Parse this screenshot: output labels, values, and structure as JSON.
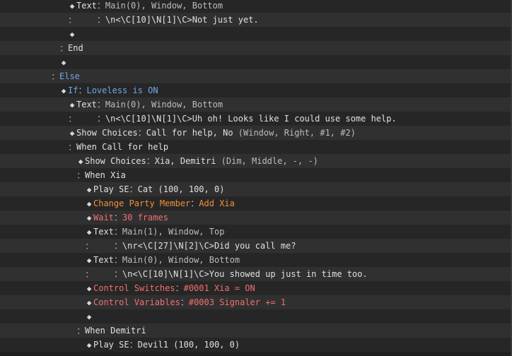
{
  "colors": {
    "default": "#e0e0e0",
    "params": "#bdbdbd",
    "flow": "#6fa8e8",
    "party": "#f0923a",
    "control": "#f07070"
  },
  "rows": [
    {
      "indent": 96,
      "marker": "diamond",
      "segs": [
        [
          "default",
          "Text"
        ],
        [
          "params",
          "："
        ],
        [
          "params",
          "Main(0), Window, Bottom"
        ]
      ]
    },
    {
      "indent": 96,
      "marker": "colon",
      "segs": [
        [
          "params",
          "    ："
        ],
        [
          "default",
          "\\n<\\C[10]\\N[1]\\C>Not just yet."
        ]
      ]
    },
    {
      "indent": 96,
      "marker": "diamond",
      "segs": []
    },
    {
      "indent": 84,
      "marker": "colon",
      "segs": [
        [
          "default",
          "End"
        ]
      ]
    },
    {
      "indent": 84,
      "marker": "diamond",
      "segs": []
    },
    {
      "indent": 72,
      "marker": "colon",
      "segs": [
        [
          "flow",
          "Else"
        ]
      ]
    },
    {
      "indent": 84,
      "marker": "diamond",
      "segs": [
        [
          "flow",
          "If"
        ],
        [
          "params",
          "："
        ],
        [
          "flow",
          "Loveless is ON"
        ]
      ]
    },
    {
      "indent": 96,
      "marker": "diamond",
      "segs": [
        [
          "default",
          "Text"
        ],
        [
          "params",
          "："
        ],
        [
          "params",
          "Main(0), Window, Bottom"
        ]
      ]
    },
    {
      "indent": 96,
      "marker": "colon",
      "segs": [
        [
          "params",
          "    ："
        ],
        [
          "default",
          "\\n<\\C[10]\\N[1]\\C>Uh oh! Looks like I could use some help."
        ]
      ]
    },
    {
      "indent": 96,
      "marker": "diamond",
      "segs": [
        [
          "default",
          "Show Choices"
        ],
        [
          "params",
          "："
        ],
        [
          "default",
          "Call for help, No "
        ],
        [
          "params",
          "(Window, Right, #1, #2)"
        ]
      ]
    },
    {
      "indent": 96,
      "marker": "colon",
      "segs": [
        [
          "default",
          "When Call for help"
        ]
      ]
    },
    {
      "indent": 108,
      "marker": "diamond",
      "segs": [
        [
          "default",
          "Show Choices"
        ],
        [
          "params",
          "："
        ],
        [
          "default",
          "Xia, Demitri "
        ],
        [
          "params",
          "(Dim, Middle, -, -)"
        ]
      ]
    },
    {
      "indent": 108,
      "marker": "colon",
      "segs": [
        [
          "default",
          "When Xia"
        ]
      ]
    },
    {
      "indent": 120,
      "marker": "diamond",
      "segs": [
        [
          "default",
          "Play SE"
        ],
        [
          "params",
          "："
        ],
        [
          "default",
          "Cat (100, 100, 0)"
        ]
      ]
    },
    {
      "indent": 120,
      "marker": "diamond",
      "segs": [
        [
          "party",
          "Change Party Member"
        ],
        [
          "params",
          "："
        ],
        [
          "party",
          "Add Xia"
        ]
      ]
    },
    {
      "indent": 120,
      "marker": "diamond",
      "segs": [
        [
          "control",
          "Wait"
        ],
        [
          "params",
          "："
        ],
        [
          "control",
          "30 frames"
        ]
      ]
    },
    {
      "indent": 120,
      "marker": "diamond",
      "segs": [
        [
          "default",
          "Text"
        ],
        [
          "params",
          "："
        ],
        [
          "params",
          "Main(1), Window, Top"
        ]
      ]
    },
    {
      "indent": 120,
      "marker": "colon",
      "segs": [
        [
          "params",
          "    ："
        ],
        [
          "default",
          "\\nr<\\C[27]\\N[2]\\C>Did you call me?"
        ]
      ]
    },
    {
      "indent": 120,
      "marker": "diamond",
      "segs": [
        [
          "default",
          "Text"
        ],
        [
          "params",
          "："
        ],
        [
          "params",
          "Main(0), Window, Bottom"
        ]
      ]
    },
    {
      "indent": 120,
      "marker": "colon",
      "segs": [
        [
          "params",
          "    ："
        ],
        [
          "default",
          "\\n<\\C[10]\\N[1]\\C>You showed up just in time too."
        ]
      ]
    },
    {
      "indent": 120,
      "marker": "diamond",
      "segs": [
        [
          "control",
          "Control Switches"
        ],
        [
          "params",
          "："
        ],
        [
          "control",
          "#0001 Xia = ON"
        ]
      ]
    },
    {
      "indent": 120,
      "marker": "diamond",
      "segs": [
        [
          "control",
          "Control Variables"
        ],
        [
          "params",
          "："
        ],
        [
          "control",
          "#0003 Signaler += 1"
        ]
      ]
    },
    {
      "indent": 120,
      "marker": "diamond",
      "segs": []
    },
    {
      "indent": 108,
      "marker": "colon",
      "segs": [
        [
          "default",
          "When Demitri"
        ]
      ]
    },
    {
      "indent": 120,
      "marker": "diamond",
      "segs": [
        [
          "default",
          "Play SE"
        ],
        [
          "params",
          "："
        ],
        [
          "default",
          "Devil1 (100, 100, 0)"
        ]
      ]
    }
  ]
}
